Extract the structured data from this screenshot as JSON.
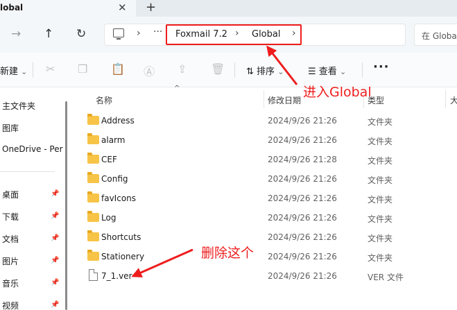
{
  "tab": {
    "title": "lobal",
    "close_glyph": "✕",
    "new_glyph": "+"
  },
  "nav": {
    "forward_icon": "arrow-right-icon",
    "up_icon": "arrow-up-icon",
    "refresh_icon": "refresh-icon",
    "more_glyph": "···",
    "breadcrumbs": [
      "Foxmail 7.2",
      "Global"
    ],
    "chevron_glyph": "›",
    "search_placeholder": "在 Globa"
  },
  "toolbar": {
    "new_label": "新建",
    "new_caret": "⌄",
    "sort_label": "排序",
    "sort_caret": "⌄",
    "view_label": "查看",
    "view_caret": "⌄",
    "more_glyph": "···",
    "icons": [
      "cut-icon",
      "copy-icon",
      "paste-icon",
      "rename-icon",
      "share-icon",
      "delete-icon"
    ]
  },
  "sidebar": {
    "items": [
      {
        "label": "主文件夹",
        "pinned": false
      },
      {
        "label": "图库",
        "pinned": false
      },
      {
        "label": "OneDrive - Per",
        "pinned": false
      },
      {
        "label": "桌面",
        "pinned": true
      },
      {
        "label": "下载",
        "pinned": true
      },
      {
        "label": "文档",
        "pinned": true
      },
      {
        "label": "图片",
        "pinned": true
      },
      {
        "label": "音乐",
        "pinned": true
      },
      {
        "label": "视频",
        "pinned": true
      }
    ],
    "pin_glyph": "📌"
  },
  "columns": {
    "name": "名称",
    "modified": "修改日期",
    "type": "类型",
    "size": "大"
  },
  "files": [
    {
      "name": "Address",
      "modified": "2024/9/26 21:26",
      "type": "文件夹",
      "kind": "folder"
    },
    {
      "name": "alarm",
      "modified": "2024/9/26 21:26",
      "type": "文件夹",
      "kind": "folder"
    },
    {
      "name": "CEF",
      "modified": "2024/9/26 21:28",
      "type": "文件夹",
      "kind": "folder"
    },
    {
      "name": "Config",
      "modified": "2024/9/26 21:26",
      "type": "文件夹",
      "kind": "folder"
    },
    {
      "name": "favIcons",
      "modified": "2024/9/26 21:26",
      "type": "文件夹",
      "kind": "folder"
    },
    {
      "name": "Log",
      "modified": "2024/9/26 21:26",
      "type": "文件夹",
      "kind": "folder"
    },
    {
      "name": "Shortcuts",
      "modified": "2024/9/26 21:26",
      "type": "文件夹",
      "kind": "folder"
    },
    {
      "name": "Stationery",
      "modified": "2024/9/26 21:26",
      "type": "文件夹",
      "kind": "folder"
    },
    {
      "name": "7_1.ver",
      "modified": "2024/9/26 21:26",
      "type": "VER 文件",
      "kind": "file"
    }
  ],
  "annotations": {
    "enter_global": "进入Global",
    "delete_this": "删除这个",
    "color": "#ee1d1d"
  }
}
